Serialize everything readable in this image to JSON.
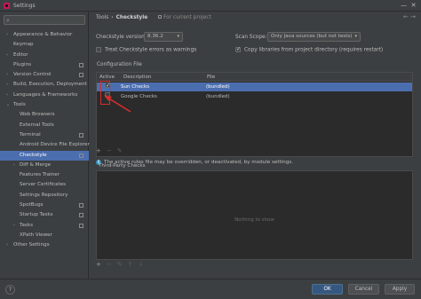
{
  "window": {
    "title": "Settings",
    "min": "—",
    "close": "✕"
  },
  "sidebar": {
    "search_icon": "search-icon",
    "items": [
      {
        "label": "Appearance & Behavior",
        "level": 0,
        "expandable": true
      },
      {
        "label": "Keymap",
        "level": 0,
        "expandable": false
      },
      {
        "label": "Editor",
        "level": 0,
        "expandable": true
      },
      {
        "label": "Plugins",
        "level": 0,
        "expandable": false,
        "proj": true
      },
      {
        "label": "Version Control",
        "level": 0,
        "expandable": true,
        "proj": true
      },
      {
        "label": "Build, Execution, Deployment",
        "level": 0,
        "expandable": true
      },
      {
        "label": "Languages & Frameworks",
        "level": 0,
        "expandable": true
      },
      {
        "label": "Tools",
        "level": 0,
        "expanded": true
      },
      {
        "label": "Web Browsers",
        "level": 1
      },
      {
        "label": "External Tools",
        "level": 1
      },
      {
        "label": "Terminal",
        "level": 1,
        "proj": true
      },
      {
        "label": "Android Device File Explorer",
        "level": 1
      },
      {
        "label": "Checkstyle",
        "level": 1,
        "selected": true,
        "proj": true
      },
      {
        "label": "Diff & Merge",
        "level": 1,
        "expandable": true
      },
      {
        "label": "Features Trainer",
        "level": 1
      },
      {
        "label": "Server Certificates",
        "level": 1
      },
      {
        "label": "Settings Repository",
        "level": 1
      },
      {
        "label": "SpotBugs",
        "level": 1,
        "proj": true
      },
      {
        "label": "Startup Tasks",
        "level": 1,
        "proj": true
      },
      {
        "label": "Tasks",
        "level": 1,
        "expandable": true,
        "proj": true
      },
      {
        "label": "XPath Viewer",
        "level": 1
      },
      {
        "label": "Other Settings",
        "level": 0,
        "expandable": true
      }
    ]
  },
  "breadcrumb": {
    "parent": "Tools",
    "sep": "›",
    "current": "Checkstyle",
    "scope": "For current project",
    "back": "←",
    "forward": "→"
  },
  "checkstyle": {
    "version_label": "Checkstyle version:",
    "version_value": "8.36.2",
    "scan_scope_label": "Scan Scope:",
    "scan_scope_value": "Only Java sources (but not tests)",
    "treat_errors_label": "Treat Checkstyle errors as warnings",
    "treat_errors_checked": false,
    "copy_libs_label": "Copy libraries from project directory (requires restart)",
    "copy_libs_checked": true
  },
  "config_file": {
    "section_label": "Configuration File",
    "columns": {
      "active": "Active",
      "description": "Description",
      "file": "File"
    },
    "rows": [
      {
        "active": true,
        "description": "Sun Checks",
        "file": "(bundled)",
        "selected": true
      },
      {
        "active": false,
        "description": "Google Checks",
        "file": "(bundled)",
        "selected": false
      }
    ],
    "toolbar": {
      "add": "+",
      "remove": "−",
      "edit": "✎"
    },
    "info_text": "The active rules file may be overridden, or deactivated, by module settings."
  },
  "third_party": {
    "section_label": "Third-Party Checks",
    "empty_text": "Nothing to show",
    "toolbar": {
      "add": "+",
      "remove": "−",
      "edit": "✎",
      "up": "↑",
      "down": "↓"
    }
  },
  "footer": {
    "help": "?",
    "ok": "OK",
    "cancel": "Cancel",
    "apply": "Apply"
  },
  "colors": {
    "accent": "#4b6eaf",
    "annotation": "#d62d2d"
  }
}
